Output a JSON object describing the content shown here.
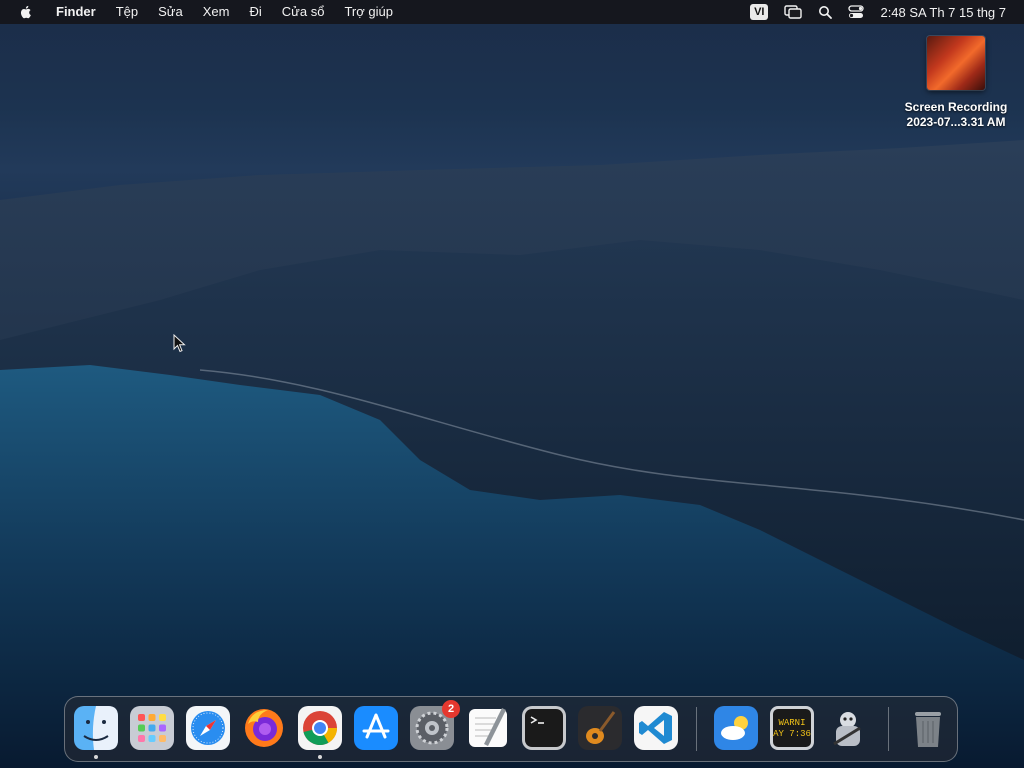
{
  "menubar": {
    "app_name": "Finder",
    "items": [
      "Tệp",
      "Sửa",
      "Xem",
      "Đi",
      "Cửa sổ",
      "Trợ giúp"
    ],
    "input_source": "VI",
    "clock": "2:48 SA Th 7 15 thg 7"
  },
  "desktop": {
    "items": [
      {
        "label_line1": "Screen Recording",
        "label_line2": "2023-07...3.31 AM"
      }
    ]
  },
  "dock": {
    "apps": [
      {
        "name": "Finder",
        "icon": "finder-icon",
        "running": true
      },
      {
        "name": "Launchpad",
        "icon": "launchpad-icon",
        "running": false
      },
      {
        "name": "Safari",
        "icon": "safari-icon",
        "running": false
      },
      {
        "name": "Firefox",
        "icon": "firefox-icon",
        "running": false
      },
      {
        "name": "Google Chrome",
        "icon": "chrome-icon",
        "running": true
      },
      {
        "name": "App Store",
        "icon": "app-store-icon",
        "running": false
      },
      {
        "name": "System Preferences",
        "icon": "gear-icon",
        "running": false,
        "badge": "2"
      },
      {
        "name": "TextEdit",
        "icon": "textedit-icon",
        "running": false
      },
      {
        "name": "Terminal",
        "icon": "terminal-icon",
        "running": false
      },
      {
        "name": "GarageBand",
        "icon": "guitar-icon",
        "running": false
      },
      {
        "name": "Visual Studio Code",
        "icon": "vscode-icon",
        "running": false
      },
      {
        "name": "Weather",
        "icon": "weather-icon",
        "running": false
      },
      {
        "name": "Console",
        "icon": "console-icon",
        "running": false,
        "text_line1": "WARNI",
        "text_line2": "AY 7:36"
      },
      {
        "name": "Automator",
        "icon": "automator-icon",
        "running": false
      },
      {
        "name": "Trash",
        "icon": "trash-icon",
        "running": false
      }
    ]
  },
  "colors": {
    "menubar_bg": "#141418",
    "badge_red": "#e5382f",
    "accent_blue": "#1a8cff"
  }
}
